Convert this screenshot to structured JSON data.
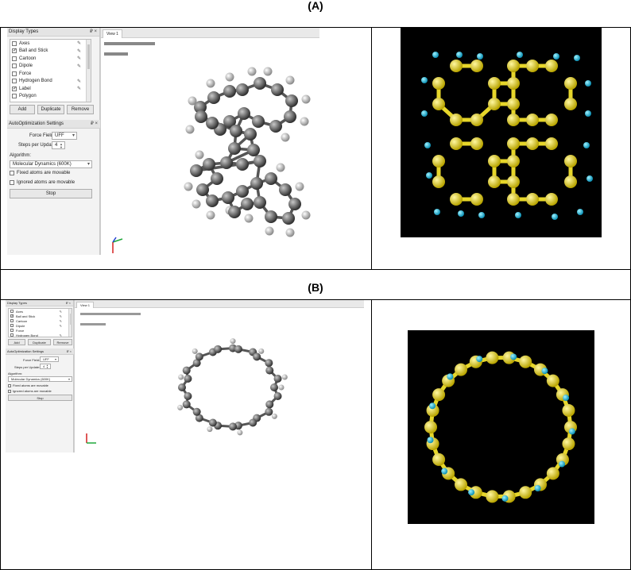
{
  "figure": {
    "label_a": "(A)",
    "label_b": "(B)"
  },
  "panel_a": {
    "display_types": {
      "title": "Display Types",
      "controls": "₽ ×",
      "items": [
        {
          "label": "Axes",
          "checked": false,
          "editable": true
        },
        {
          "label": "Ball and Stick",
          "checked": true,
          "editable": true
        },
        {
          "label": "Cartoon",
          "checked": false,
          "editable": true
        },
        {
          "label": "Dipole",
          "checked": false,
          "editable": true
        },
        {
          "label": "Force",
          "checked": false,
          "editable": false
        },
        {
          "label": "Hydrogen Bond",
          "checked": false,
          "editable": true
        },
        {
          "label": "Label",
          "checked": true,
          "editable": true
        },
        {
          "label": "Polygon",
          "checked": false,
          "editable": false
        }
      ],
      "add": "Add",
      "duplicate": "Duplicate",
      "remove": "Remove"
    },
    "autoopt": {
      "title": "AutoOptimization Settings",
      "controls": "₽ ×",
      "force_field_label": "Force Field:",
      "force_field_value": "UFF",
      "steps_label": "Steps per Update:",
      "steps_value": "4",
      "algorithm_label": "Algorithm:",
      "algorithm_value": "Molecular Dynamics (600K)",
      "fixed_label": "Fixed atoms are movable",
      "ignored_label": "Ignored atoms are movable",
      "stop": "Stop"
    },
    "view": {
      "tab": "View 1"
    }
  },
  "panel_b": {
    "display_types": {
      "title": "Display Types",
      "controls": "₽ ×",
      "items": [
        {
          "label": "Axes",
          "checked": false,
          "editable": true
        },
        {
          "label": "Ball and Stick",
          "checked": true,
          "editable": true
        },
        {
          "label": "Cartoon",
          "checked": false,
          "editable": true
        },
        {
          "label": "Dipole",
          "checked": false,
          "editable": true
        },
        {
          "label": "Force",
          "checked": false,
          "editable": false
        },
        {
          "label": "Hydrogen Bond",
          "checked": false,
          "editable": true
        }
      ],
      "add": "Add",
      "duplicate": "Duplicate",
      "remove": "Remove"
    },
    "autoopt": {
      "title": "AutoOptimization Settings",
      "controls": "₽ ×",
      "force_field_label": "Force Field:",
      "force_field_value": "UFF",
      "steps_label": "Steps per Update:",
      "steps_value": "4",
      "algorithm_label": "Algorithm:",
      "algorithm_value": "Molecular Dynamics (600K)",
      "fixed_label": "Fixed atoms are movable",
      "ignored_label": "Ignored atoms are movable",
      "stop": "Stop"
    },
    "view": {
      "tab": "View 1"
    }
  },
  "colors": {
    "render_bg": "#000000",
    "carbon_yellow": "#e6d62a",
    "hydrogen_cyan": "#22c4e8",
    "grey_atom": "#606060",
    "axis_green": "#1fa83a",
    "axis_red": "#d42020",
    "axis_blue": "#2040d0"
  }
}
